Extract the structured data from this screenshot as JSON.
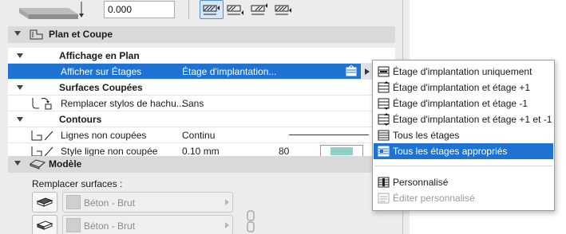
{
  "toolbar": {
    "offset_value": "0.000"
  },
  "sections": {
    "plan_coupe": "Plan et Coupe",
    "modele": "Modèle"
  },
  "tree": {
    "group_affichage": "Affichage en Plan",
    "afficher_label": "Afficher sur Étages",
    "afficher_value": "Étage d'implantation...",
    "group_surfaces": "Surfaces Coupées",
    "remplacer_label": "Remplacer stylos de hachu...",
    "remplacer_value": "Sans",
    "group_contours": "Contours",
    "lignes_label": "Lignes non coupées",
    "lignes_value": "Continu",
    "style_label": "Style ligne non coupée",
    "style_value": "0.10 mm",
    "style_pen": "80"
  },
  "modele": {
    "remplacer_surfaces_label": "Remplacer surfaces :",
    "surface_1": "Béton - Brut",
    "surface_2": "Béton - Brut"
  },
  "menu": {
    "items": [
      "Étage d'implantation uniquement",
      "Étage d'implantation et étage +1",
      "Étage d'implantation et étage -1",
      "Étage d'implantation et étage +1 et -1",
      "Tous les étages",
      "Tous les étages appropriés"
    ],
    "personnalise": "Personnalisé",
    "editer_personnalise": "Éditer personnalisé",
    "highlighted_index": 5
  },
  "colors": {
    "selection": "#1d72d2",
    "swatch": "#8fd1c6"
  }
}
